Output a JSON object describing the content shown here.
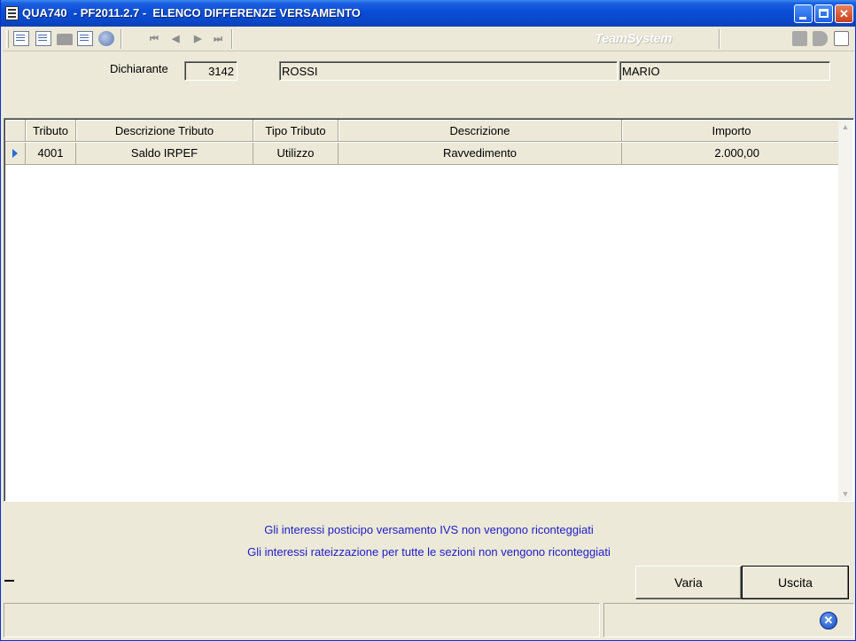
{
  "window": {
    "title": "QUA740  - PF2011.2.7 -  ELENCO DIFFERENZE VERSAMENTO",
    "min_icon": "minimize-icon",
    "max_icon": "maximize-icon",
    "close_label": "✕"
  },
  "toolbar": {
    "brand": "TeamSystem",
    "nav": {
      "first": "⏮",
      "prev": "◀",
      "next": "▶",
      "last": "⏭"
    }
  },
  "header": {
    "dichiarante_label": "Dichiarante",
    "code": "3142",
    "cognome": "ROSSI",
    "nome": "MARIO"
  },
  "grid": {
    "columns": [
      "Tributo",
      "Descrizione Tributo",
      "Tipo Tributo",
      "Descrizione",
      "Importo"
    ],
    "rows": [
      {
        "tributo": "4001",
        "descrizione_tributo": "Saldo IRPEF",
        "tipo_tributo": "Utilizzo",
        "descrizione": "Ravvedimento",
        "importo": "2.000,00"
      }
    ]
  },
  "messages": {
    "line1": "Gli interessi posticipo versamento IVS non vengono riconteggiati",
    "line2": "Gli interessi rateizzazione per tutte le sezioni non vengono riconteggiati"
  },
  "buttons": {
    "varia": "Varia",
    "uscita": "Uscita"
  },
  "status": {
    "close_icon_glyph": "✕"
  },
  "colors": {
    "titlebar": "#0a47c9",
    "message_text": "#2020c8",
    "window_bg": "#ece9d8",
    "close_button": "#c9401a"
  }
}
